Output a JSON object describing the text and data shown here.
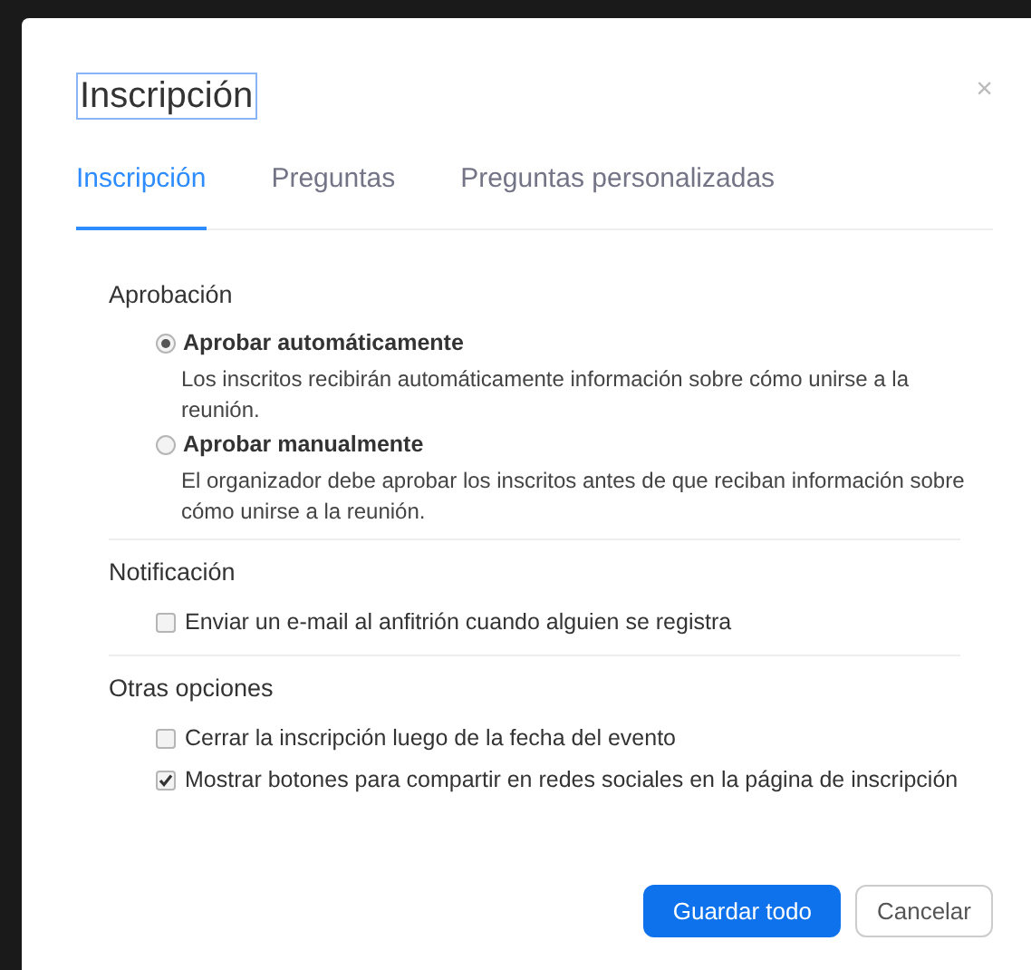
{
  "dialog": {
    "title": "Inscripción",
    "close": "×"
  },
  "tabs": [
    {
      "label": "Inscripción",
      "selected": true
    },
    {
      "label": "Preguntas",
      "selected": false
    },
    {
      "label": "Preguntas personalizadas",
      "selected": false
    }
  ],
  "sections": [
    {
      "heading": "Aprobación",
      "options": [
        {
          "kind": "radio",
          "label": "Aprobar automáticamente",
          "selected": true,
          "description": "Los inscritos recibirán automáticamente información sobre cómo unirse a la reunión."
        },
        {
          "kind": "radio",
          "label": "Aprobar manualmente",
          "selected": false,
          "description": "El organizador debe aprobar los inscritos antes de que reciban información sobre cómo unirse a la reunión."
        }
      ]
    },
    {
      "heading": "Notificación",
      "options": [
        {
          "kind": "checkbox",
          "label": "Enviar un e-mail al anfitrión cuando alguien se registra",
          "checked": false
        }
      ]
    },
    {
      "heading": "Otras opciones",
      "options": [
        {
          "kind": "checkbox",
          "label": "Cerrar la inscripción luego de la fecha del evento",
          "checked": false
        },
        {
          "kind": "checkbox",
          "label": "Mostrar botones para compartir en redes sociales en la página de inscripción",
          "checked": true
        }
      ]
    }
  ],
  "buttons": {
    "primary": "Guardar todo",
    "secondary": "Cancelar"
  }
}
